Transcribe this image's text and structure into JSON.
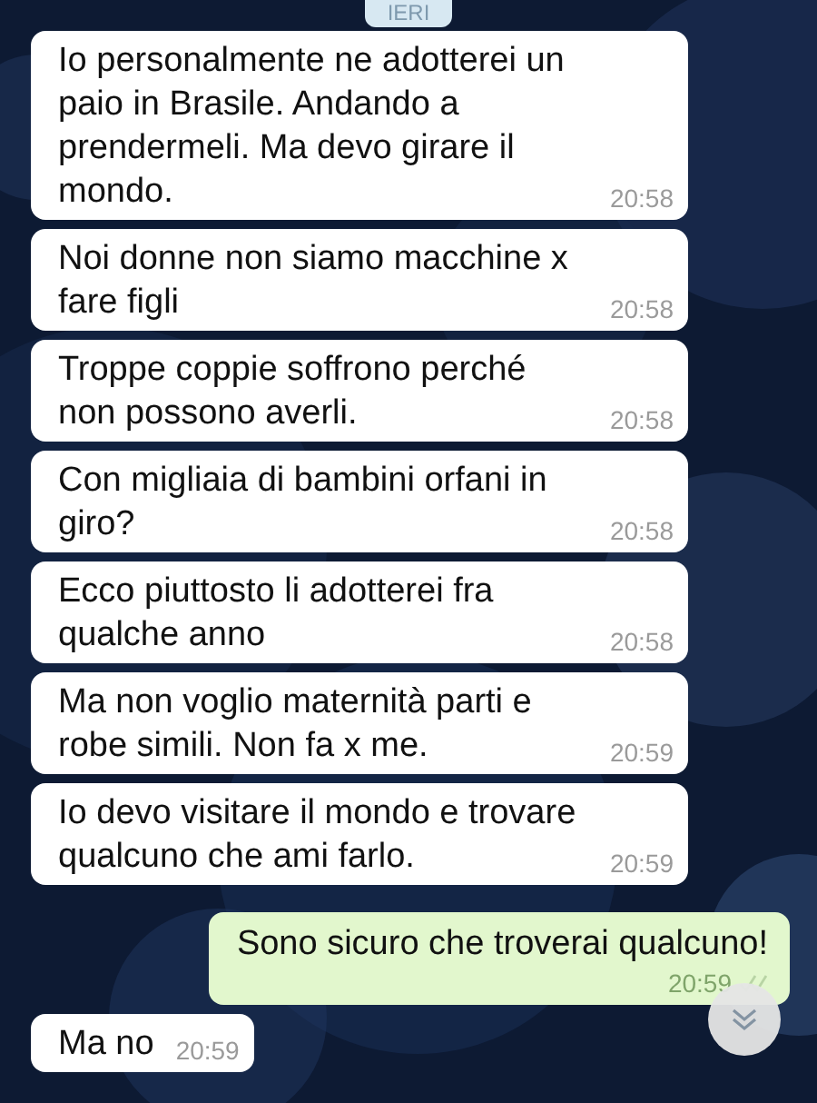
{
  "date_chip": "IERI",
  "messages": [
    {
      "kind": "incoming",
      "text": "Io personalmente ne adotterei un paio in Brasile. Andando a prendermeli. Ma devo girare il mondo.",
      "time": "20:58"
    },
    {
      "kind": "incoming",
      "text": "Noi donne non siamo macchine x fare figli",
      "time": "20:58"
    },
    {
      "kind": "incoming",
      "text": "Troppe coppie soffrono perché non possono averli.",
      "time": "20:58"
    },
    {
      "kind": "incoming",
      "text": "Con migliaia di bambini orfani in giro?",
      "time": "20:58"
    },
    {
      "kind": "incoming",
      "text": "Ecco piuttosto li adotterei fra qualche anno",
      "time": "20:58"
    },
    {
      "kind": "incoming",
      "text": "Ma non voglio maternità parti e robe simili. Non fa x me.",
      "time": "20:59"
    },
    {
      "kind": "incoming",
      "text": "Io devo visitare il mondo e trovare qualcuno che ami farlo.",
      "time": "20:59"
    },
    {
      "kind": "outgoing",
      "text": "Sono sicuro che troverai qualcuno!",
      "time": "20:59",
      "read": true
    },
    {
      "kind": "incoming",
      "text": "Ma no",
      "time": "20:59"
    }
  ]
}
